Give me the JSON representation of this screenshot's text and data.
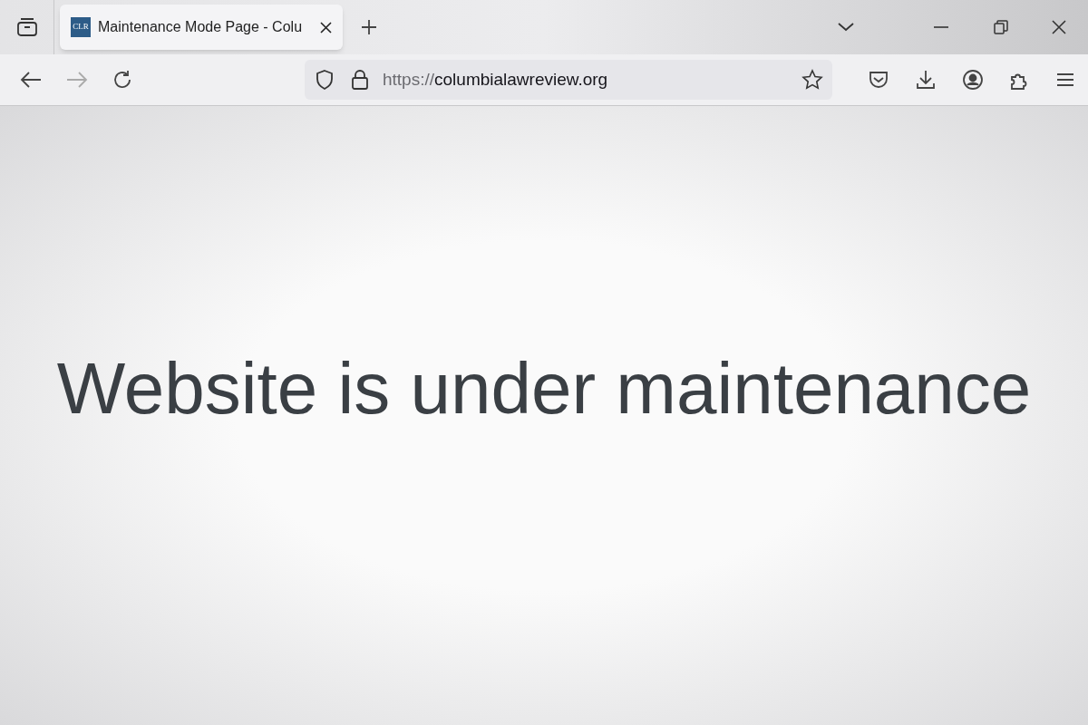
{
  "tabs": [
    {
      "favicon": "CLR",
      "title": "Maintenance Mode Page - Colu",
      "selected": true
    }
  ],
  "nav": {
    "back_disabled": false,
    "forward_disabled": true
  },
  "address_bar": {
    "scheme": "https://",
    "host": "columbialawreview.org"
  },
  "page": {
    "heading": "Website is under maintenance"
  }
}
